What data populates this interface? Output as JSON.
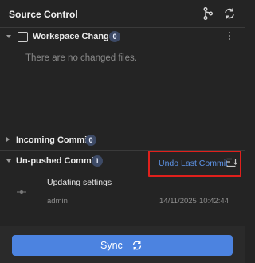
{
  "header": {
    "title": "Source Control"
  },
  "workspace": {
    "label": "Workspace Changes",
    "count": "0",
    "empty_message": "There are no changed files."
  },
  "incoming": {
    "label": "Incoming Commits",
    "count": "0"
  },
  "unpushed": {
    "label": "Un-pushed Commits",
    "count": "1",
    "undo_label": "Undo Last Commit",
    "commits": [
      {
        "message": "Updating settings",
        "author": "admin",
        "date": "14/11/2025",
        "time": "10:42:44"
      }
    ]
  },
  "footer": {
    "sync_label": "Sync"
  },
  "colors": {
    "accent": "#4c83e0",
    "highlight": "#e0201c",
    "badge": "#3d4a66",
    "link": "#5d93e6"
  }
}
